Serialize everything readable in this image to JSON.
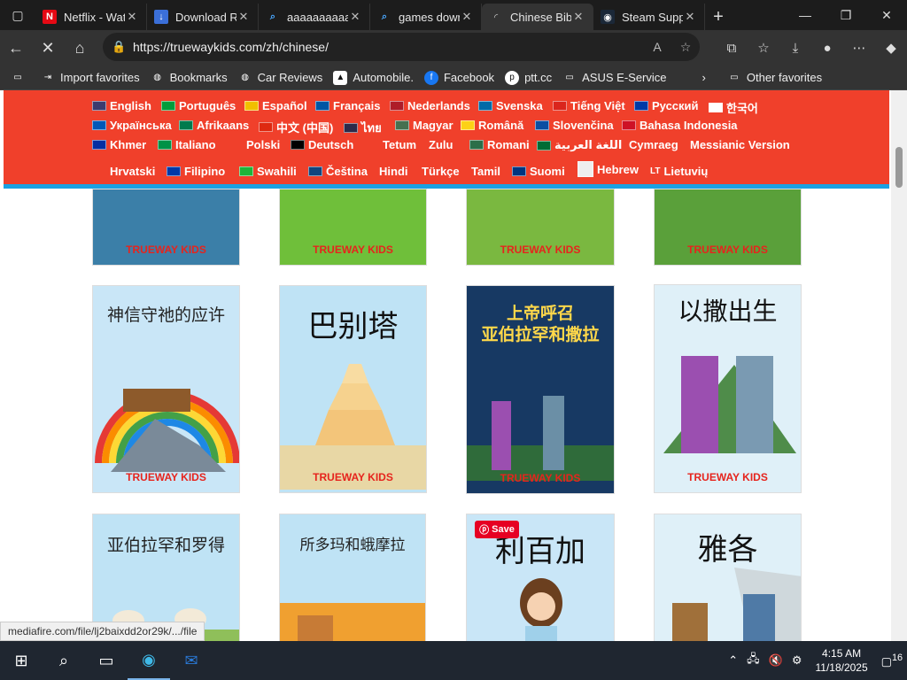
{
  "tabs": [
    {
      "label": "Netflix - Wat",
      "icon": "netflix-icon"
    },
    {
      "label": "Download R",
      "icon": "download-icon"
    },
    {
      "label": "aaaaaaaaaa",
      "icon": "search-icon"
    },
    {
      "label": "games dowr",
      "icon": "search-icon"
    },
    {
      "label": "Chinese Bibl",
      "icon": "loading-icon"
    },
    {
      "label": "Steam Suppo",
      "icon": "steam-icon"
    }
  ],
  "address": {
    "url": "https://truewaykids.com/zh/chinese/"
  },
  "favorites": [
    {
      "label": "Import favorites"
    },
    {
      "label": "Bookmarks"
    },
    {
      "label": "Car Reviews"
    },
    {
      "label": "Automobile."
    },
    {
      "label": "Facebook"
    },
    {
      "label": "ptt.cc"
    },
    {
      "label": "ASUS E-Service"
    },
    {
      "label": "Other favorites"
    }
  ],
  "languages": {
    "row1": [
      "English",
      "Português",
      "Español",
      "Français",
      "Nederlands",
      "Svenska",
      "Tiếng Việt",
      "Русский",
      "한국어"
    ],
    "row2": [
      "Українська",
      "Afrikaans",
      "中文 (中国)",
      "ไทย",
      "Magyar",
      "Română",
      "Slovenčina",
      "Bahasa Indonesia"
    ],
    "row3": [
      "Khmer",
      "Italiano",
      "Polski",
      "Deutsch",
      "Tetum",
      "Zulu",
      "Romani",
      "اللغة العربية",
      "Cymraeg",
      "Messianic Version"
    ],
    "row4": [
      "Hrvatski",
      "Filipino",
      "Swahili",
      "Čeština",
      "Hindi",
      "Türkçe",
      "Tamil",
      "Suomi",
      "Hebrew",
      "Lietuvių"
    ]
  },
  "cards": {
    "brand": "TRUEWAY KIDS",
    "c5": "神信守祂的应许",
    "c6": "巴别塔",
    "c7a": "上帝呼召",
    "c7b": "亚伯拉罕和撒拉",
    "c8": "以撒出生",
    "c9": "亚伯拉罕和罗得",
    "c10": "所多玛和蛾摩拉",
    "c11": "利百加",
    "c12": "雅各"
  },
  "pinterest": {
    "save_label": "Save"
  },
  "status_url": "mediafire.com/file/lj2baixdd2or29k/.../file",
  "taskbar": {
    "time": "4:15 AM",
    "date": "11/18/2025",
    "badge": "16"
  }
}
